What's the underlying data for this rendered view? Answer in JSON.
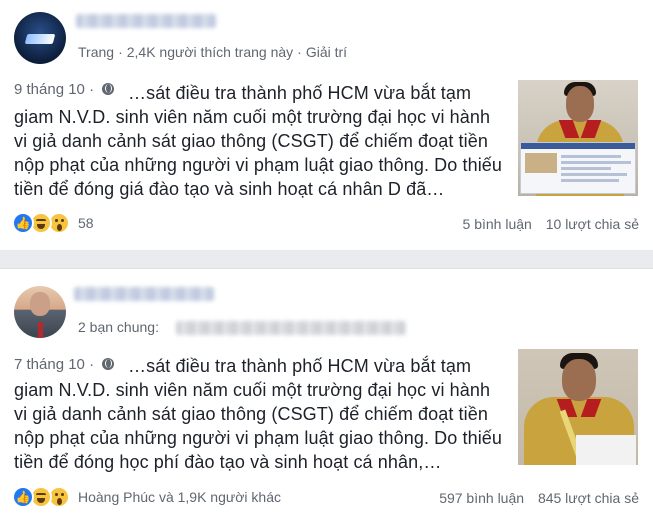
{
  "posts": [
    {
      "author_kind": "Trang",
      "likes": "2,4K người thích trang này",
      "category": "Giải trí",
      "date": "9 tháng 10",
      "body": "…sát điều tra thành phố HCM vừa bắt tạm giam N.V.D. sinh viên năm cuối một trường đại học vi hành vi giả danh cảnh sát giao thông (CSGT) để chiếm đoạt tiền nộp phạt của những người vi phạm luật giao thông. Do thiếu tiền để đóng giá đào tạo và sinh hoạt cá nhân D đã…",
      "reaction_count": "58",
      "comments": "5 bình luận",
      "shares": "10 lượt chia sẻ"
    },
    {
      "mutual": "2 bạn chung:",
      "date": "7 tháng 10",
      "body": "…sát điều tra thành phố HCM vừa bắt tạm giam N.V.D. sinh viên năm cuối một trường đại học vi hành vi giả danh cảnh sát giao thông (CSGT) để chiếm đoạt tiền nộp phạt của những người vi phạm luật giao thông. Do thiếu tiền để đóng học phí đào tạo và sinh hoạt cá nhân,…",
      "reaction_count": "Hoàng Phúc và 1,9K người khác",
      "comments": "597 bình luận",
      "shares": "845 lượt chia sẻ"
    }
  ],
  "colors": {
    "like": "#2078f4",
    "haha": "#f7c440",
    "meta": "#606770"
  },
  "icons": [
    "globe-icon",
    "like-icon",
    "haha-icon",
    "wow-icon"
  ]
}
